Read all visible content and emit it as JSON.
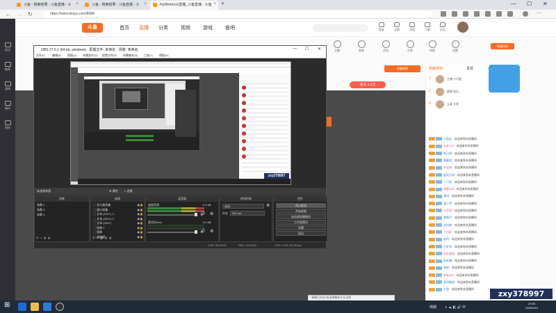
{
  "browser": {
    "tabs": [
      {
        "label": "斗鱼 - 搜索结果 - 斗鱼直播 - 斗",
        "active": false
      },
      {
        "label": "斗鱼 - 搜索结果 - 斗鱼直播 - 斗",
        "active": false
      },
      {
        "label": "FlyWinterUx直播_斗鱼直播 - 斗鱼",
        "active": true
      }
    ],
    "new_tab": "+",
    "minimize": "—",
    "maximize": "☐",
    "close": "✕",
    "url": "https://www.douyu.com/8688"
  },
  "douyu": {
    "logo": "斗鱼",
    "nav": [
      "首页",
      "直播",
      "分类",
      "视频",
      "游戏",
      "鱼吧"
    ],
    "active_nav": "直播",
    "header_icons": [
      "登录",
      "注册",
      "充值",
      "下载",
      "历史",
      "关注"
    ],
    "follow_button": "关注",
    "follow_count": "1.2万",
    "rank_button": "贡献周榜",
    "orange_button": "鱼塘任务",
    "left_nav": [
      "关注",
      "推荐",
      "游戏",
      "娱乐",
      "科技"
    ],
    "section_icons": [
      "主播",
      "鱼吧",
      "活动",
      "分享",
      "举报",
      "设置"
    ],
    "chat_tabs": [
      "贡献周榜",
      "贵宾"
    ],
    "vip_users": [
      {
        "rank": "1",
        "name": "主播 小可爱"
      },
      {
        "rank": "2",
        "name": "超管 鱼丸"
      },
      {
        "rank": "3",
        "name": "土豪 大哥"
      }
    ],
    "chat_messages": [
      {
        "user": "小鱼丸",
        "text": "欢迎来到本直播间"
      },
      {
        "user": "水友123",
        "text": "欢迎来到本直播间"
      },
      {
        "user": "鱼小娇",
        "text": "欢迎来到本直播间"
      },
      {
        "user": "弹幕君",
        "text": "欢迎来到本直播间"
      },
      {
        "user": "好运来",
        "text": "欢迎来到本直播间"
      },
      {
        "user": "星辰大海",
        "text": "欢迎来到本直播间"
      },
      {
        "user": "一只鱼",
        "text": "欢迎来到本直播间"
      },
      {
        "user": "游客888",
        "text": "欢迎来到本直播间"
      },
      {
        "user": "清风",
        "text": "欢迎来到本直播间"
      },
      {
        "user": "路人甲",
        "text": "欢迎来到本直播间"
      },
      {
        "user": "小太阳",
        "text": "欢迎来到本直播间"
      },
      {
        "user": "夜猫子",
        "text": "欢迎来到本直播间"
      },
      {
        "user": "追风者",
        "text": "欢迎来到本直播间"
      },
      {
        "user": "大白鲨",
        "text": "欢迎来到本直播间"
      },
      {
        "user": "南风",
        "text": "欢迎来到本直播间"
      },
      {
        "user": "小虾米",
        "text": "欢迎来到本直播间"
      },
      {
        "user": "鱼丸粗面",
        "text": "欢迎来到本直播间"
      },
      {
        "user": "彩虹糖",
        "text": "欢迎来到本直播间"
      },
      {
        "user": "萌新",
        "text": "欢迎来到本直播间"
      },
      {
        "user": "老铁666",
        "text": "欢迎来到本直播间"
      },
      {
        "user": "乘风破浪",
        "text": "欢迎来到本直播间"
      },
      {
        "user": "大鱼",
        "text": "欢迎来到本直播间"
      }
    ],
    "notice": "弹幕已开启 发送弹幕参与互动吧"
  },
  "obs": {
    "title": "OBS 27.0.1 (64-bit, windows) - 配置文件: 未命名 - 场景: 未命名",
    "menu": [
      "文件(F)",
      "编辑(E)",
      "视图(V)",
      "停靠部件(D)",
      "配置文件(P)",
      "场景集合(S)",
      "工具(T)",
      "帮助(H)"
    ],
    "inner_watermark": "zxy378997",
    "scene_bar_label": "未选择来源",
    "scene_bar_props": "属性",
    "scene_bar_filters": "滤镜",
    "docks": {
      "scenes": {
        "title": "场景",
        "items": [
          "场景 2",
          "场景 3",
          "场景 4"
        ]
      },
      "sources": {
        "title": "来源",
        "items": [
          "显示器采集",
          "窗口采集",
          "文本 (GDI+) 3",
          "文本 (GDI+) 2",
          "文本 (GDI+)",
          "图像 2",
          "图像",
          "媒体源"
        ]
      },
      "mixer": {
        "title": "混音器",
        "channels": [
          {
            "name": "桌面音频",
            "db": "0.0 dB"
          },
          {
            "name": "麦克风/Aux",
            "db": "0.0 dB"
          }
        ]
      },
      "transitions": {
        "title": "转场特效",
        "selected": "淡出",
        "duration_label": "时长",
        "duration": "300 ms"
      },
      "controls": {
        "title": "控件",
        "buttons": [
          "停止推流",
          "开始录制",
          "启动虚拟摄像机",
          "工作室模式",
          "设置",
          "退出"
        ]
      }
    },
    "status": {
      "live": "LIVE: 00:00:00",
      "rec": "REC: 00:00:00",
      "cpu": "CPU: 3.4%, 60.00 fps"
    }
  },
  "watermark": "zxy378997",
  "taskbar": {
    "time": "23:33",
    "date": "2022/4/19",
    "weather": "晴朗"
  }
}
